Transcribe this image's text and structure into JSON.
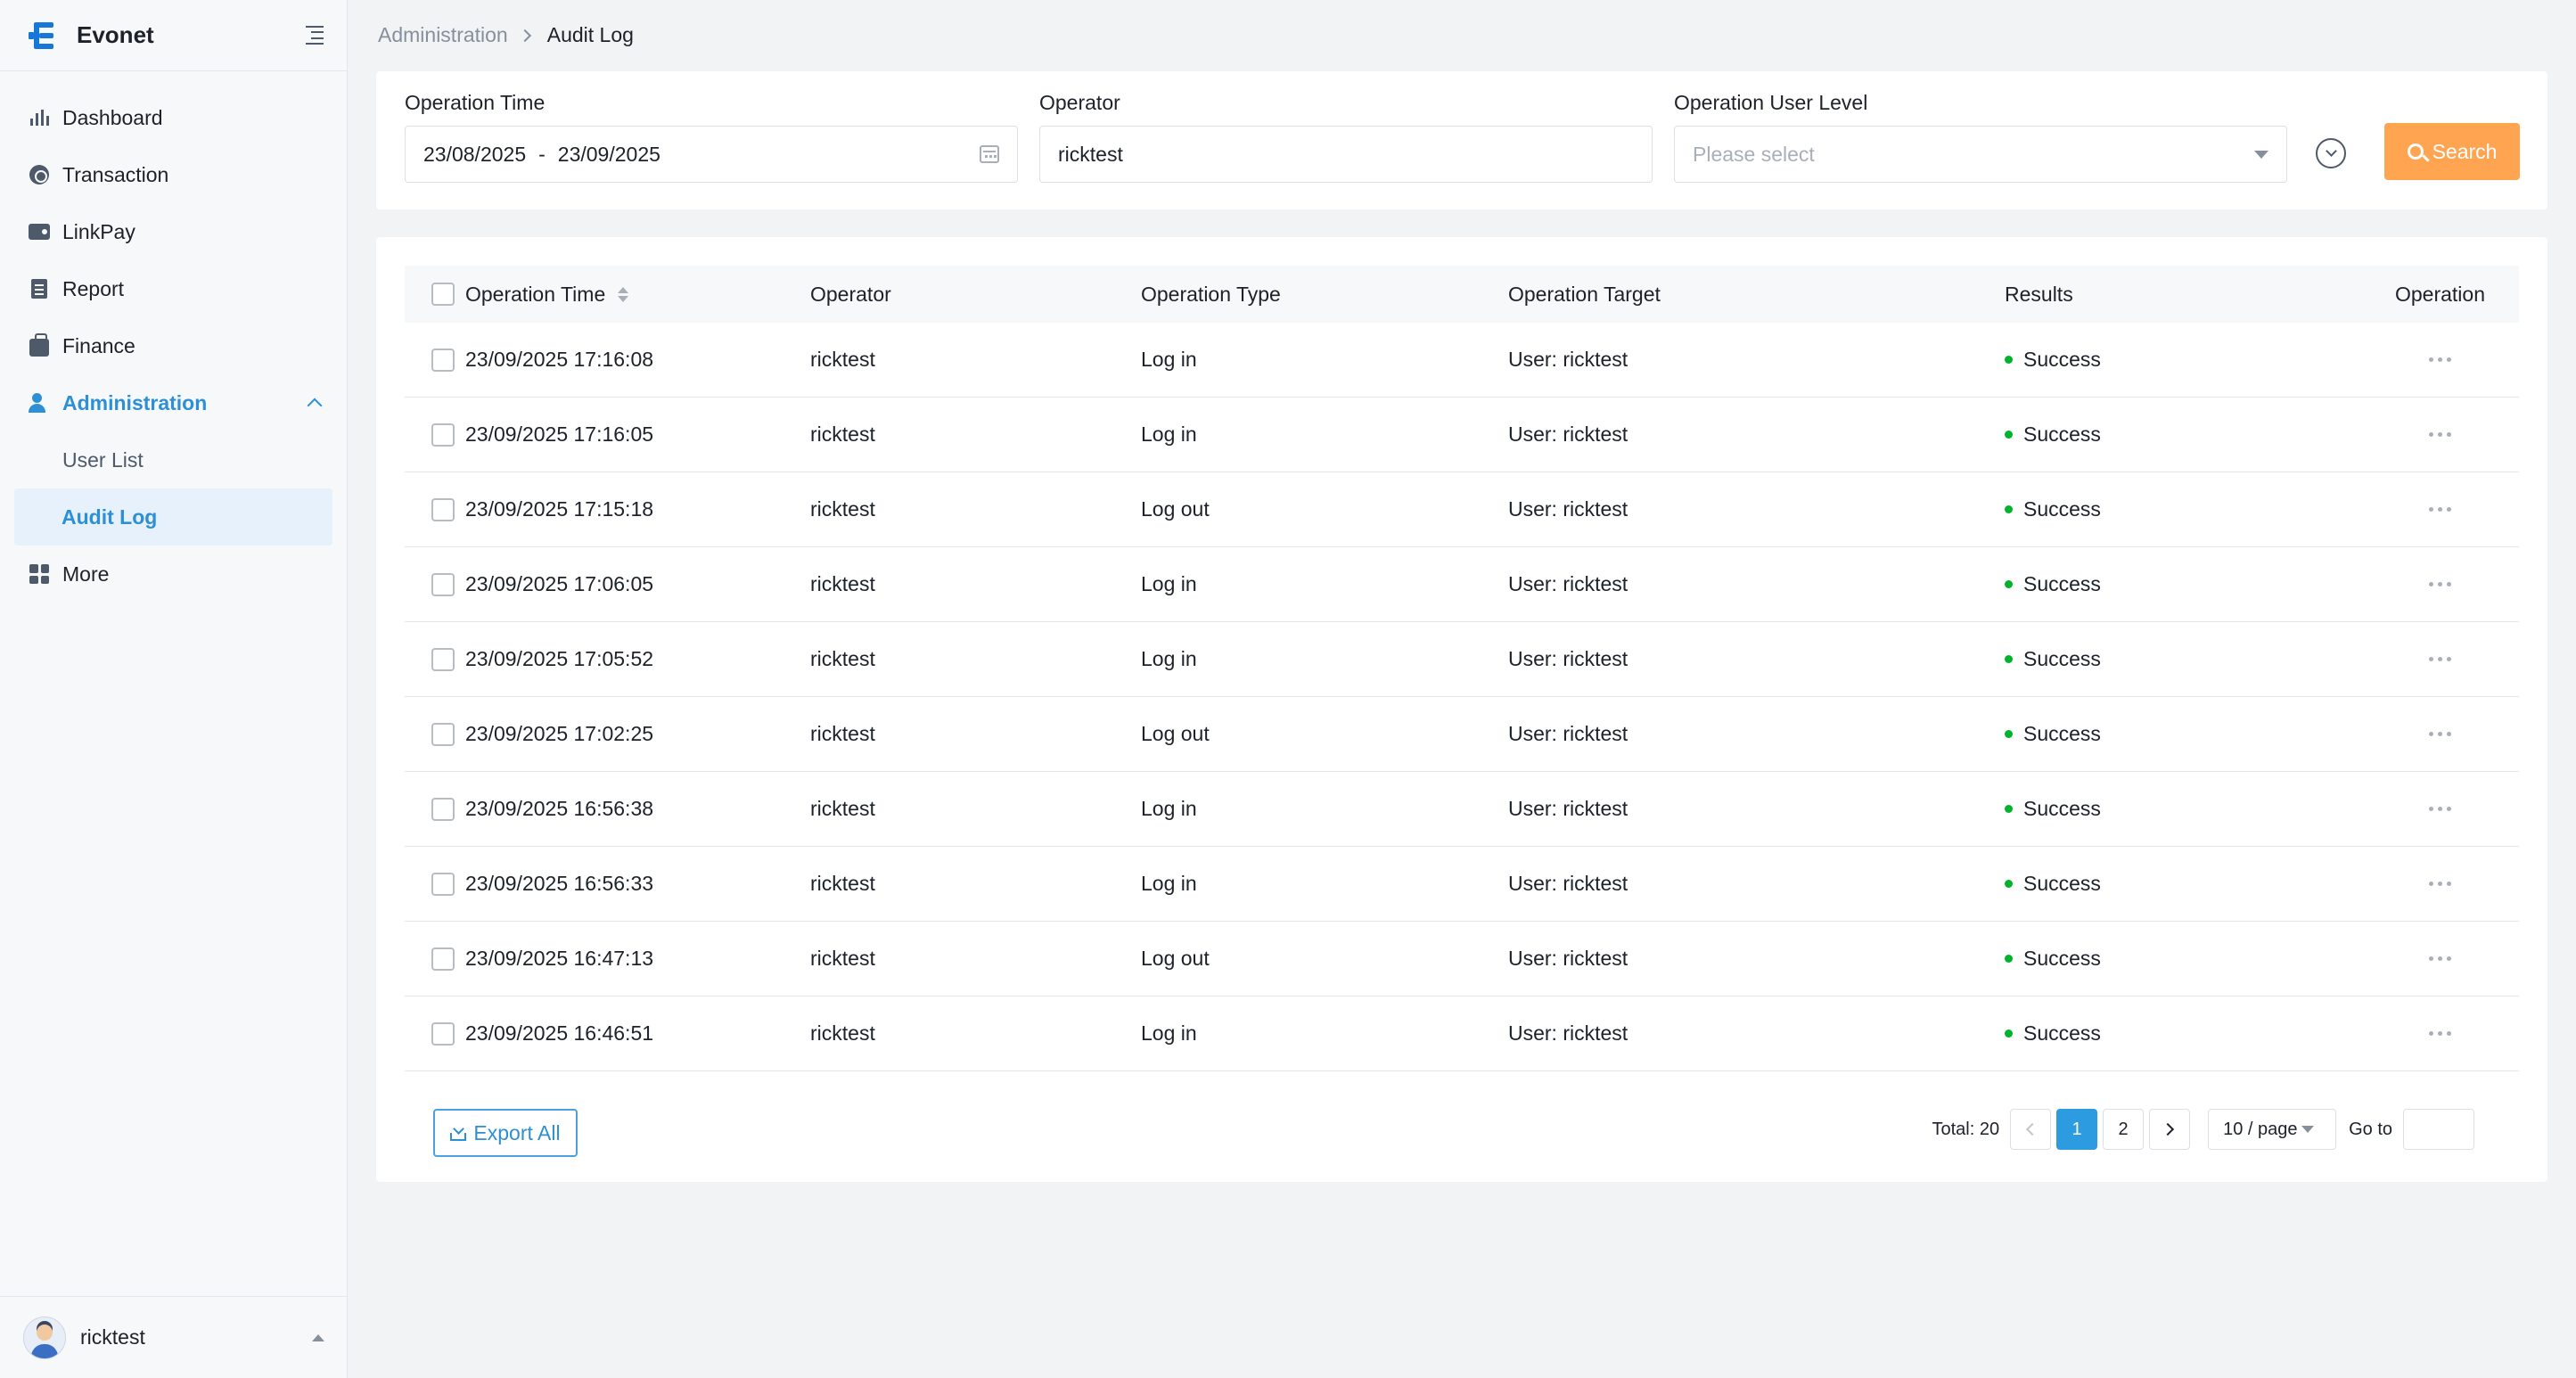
{
  "app": {
    "name": "Evonet"
  },
  "sidebar": {
    "items": [
      {
        "label": "Dashboard",
        "icon": "dashboard-icon"
      },
      {
        "label": "Transaction",
        "icon": "transaction-icon"
      },
      {
        "label": "LinkPay",
        "icon": "wallet-icon"
      },
      {
        "label": "Report",
        "icon": "report-icon"
      },
      {
        "label": "Finance",
        "icon": "finance-icon"
      },
      {
        "label": "Administration",
        "icon": "user-admin-icon",
        "expanded": true,
        "children": [
          "User List",
          "Audit Log"
        ]
      },
      {
        "label": "More",
        "icon": "grid-icon"
      }
    ],
    "user": "ricktest"
  },
  "breadcrumb": {
    "parent": "Administration",
    "current": "Audit Log"
  },
  "filters": {
    "operation_time": {
      "label": "Operation Time",
      "start": "23/08/2025",
      "separator": "-",
      "end": "23/09/2025"
    },
    "operator": {
      "label": "Operator",
      "value": "ricktest"
    },
    "user_level": {
      "label": "Operation User Level",
      "placeholder": "Please select"
    },
    "search_label": "Search"
  },
  "table": {
    "columns": [
      "Operation Time",
      "Operator",
      "Operation Type",
      "Operation Target",
      "Results",
      "Operation"
    ],
    "rows": [
      {
        "time": "23/09/2025 17:16:08",
        "operator": "ricktest",
        "type": "Log in",
        "target": "User: ricktest",
        "result": "Success"
      },
      {
        "time": "23/09/2025 17:16:05",
        "operator": "ricktest",
        "type": "Log in",
        "target": "User: ricktest",
        "result": "Success"
      },
      {
        "time": "23/09/2025 17:15:18",
        "operator": "ricktest",
        "type": "Log out",
        "target": "User: ricktest",
        "result": "Success"
      },
      {
        "time": "23/09/2025 17:06:05",
        "operator": "ricktest",
        "type": "Log in",
        "target": "User: ricktest",
        "result": "Success"
      },
      {
        "time": "23/09/2025 17:05:52",
        "operator": "ricktest",
        "type": "Log in",
        "target": "User: ricktest",
        "result": "Success"
      },
      {
        "time": "23/09/2025 17:02:25",
        "operator": "ricktest",
        "type": "Log out",
        "target": "User: ricktest",
        "result": "Success"
      },
      {
        "time": "23/09/2025 16:56:38",
        "operator": "ricktest",
        "type": "Log in",
        "target": "User: ricktest",
        "result": "Success"
      },
      {
        "time": "23/09/2025 16:56:33",
        "operator": "ricktest",
        "type": "Log in",
        "target": "User: ricktest",
        "result": "Success"
      },
      {
        "time": "23/09/2025 16:47:13",
        "operator": "ricktest",
        "type": "Log out",
        "target": "User: ricktest",
        "result": "Success"
      },
      {
        "time": "23/09/2025 16:46:51",
        "operator": "ricktest",
        "type": "Log in",
        "target": "User: ricktest",
        "result": "Success"
      }
    ]
  },
  "footer": {
    "export_label": "Export All",
    "total": "Total: 20",
    "pages": [
      "1",
      "2"
    ],
    "current_page": "1",
    "page_size": "10 / page",
    "goto_label": "Go to"
  },
  "colors": {
    "accent": "#2d8fd6",
    "search": "#ffa552",
    "success": "#00b42a"
  }
}
